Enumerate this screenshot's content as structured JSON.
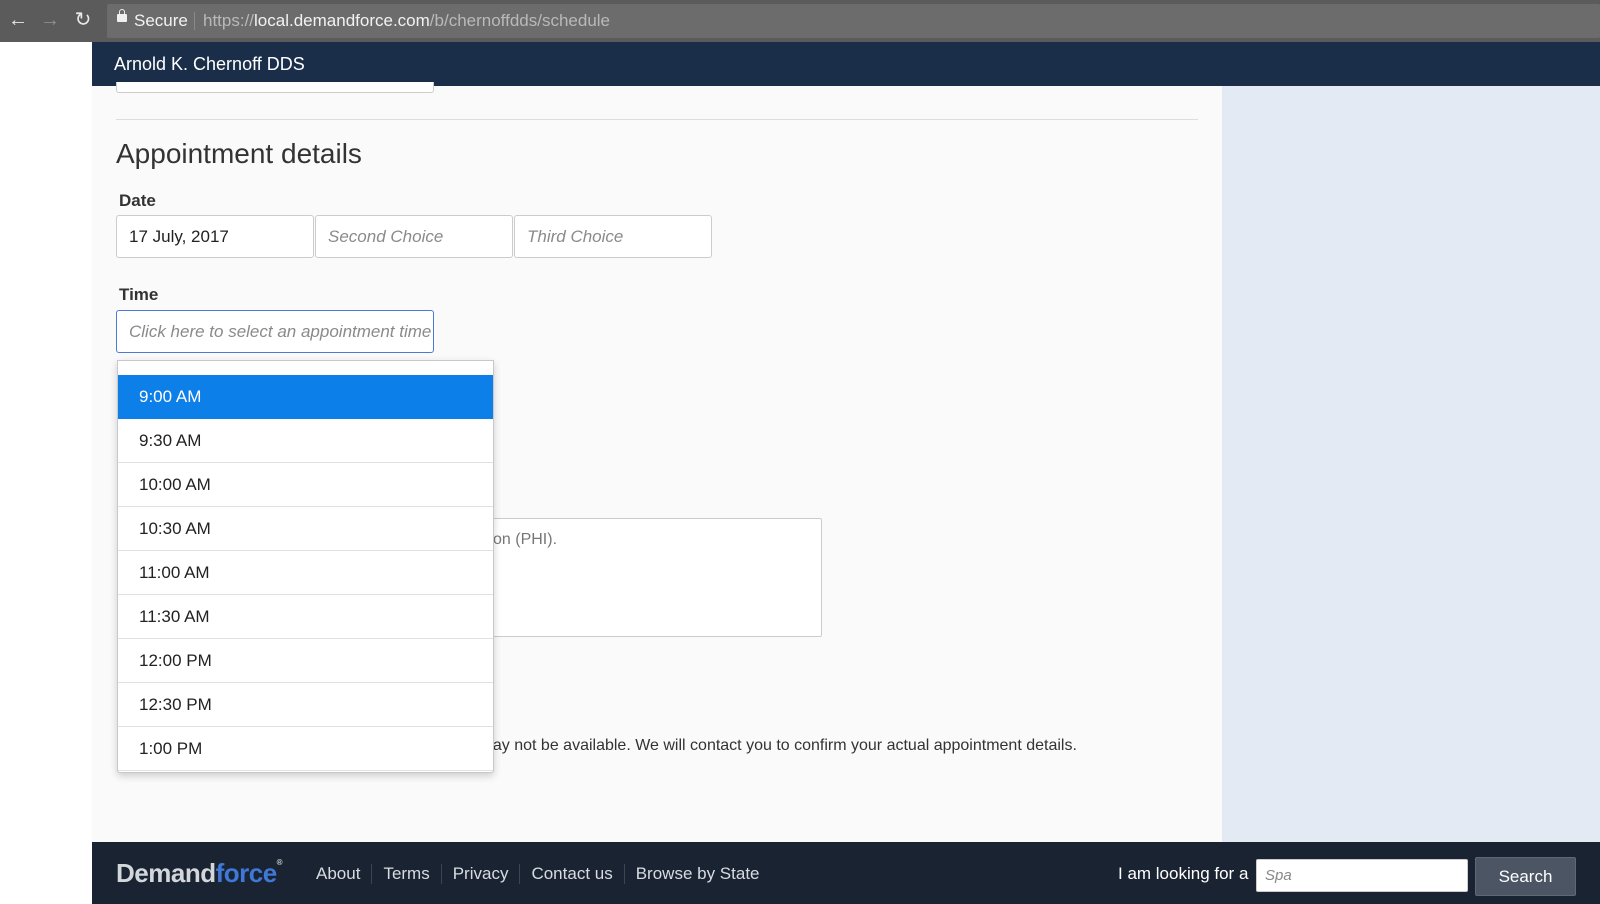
{
  "browser": {
    "secure_label": "Secure",
    "url_protocol": "https://",
    "url_host": "local.demandforce.com",
    "url_path": "/b/chernoffdds/schedule"
  },
  "header": {
    "practice_name": "Arnold K. Chernoff DDS"
  },
  "appointment": {
    "section_title": "Appointment details",
    "date_label": "Date",
    "date_value": "17 July, 2017",
    "second_choice_placeholder": "Second Choice",
    "third_choice_placeholder": "Third Choice",
    "time_label": "Time",
    "time_placeholder": "Click here to select an appointment time",
    "time_options": [
      "9:00 AM",
      "9:30 AM",
      "10:00 AM",
      "10:30 AM",
      "11:00 AM",
      "11:30 AM",
      "12:00 PM",
      "12:30 PM",
      "1:00 PM"
    ],
    "selected_time_index": 0,
    "phi_fragment": "tion (PHI).",
    "notice_fragment": "nay not be available. We will contact you to confirm your actual appointment details."
  },
  "footer": {
    "logo_part1": "Demand",
    "logo_part2": "force",
    "links": [
      "About",
      "Terms",
      "Privacy",
      "Contact us",
      "Browse by State"
    ],
    "looking_for_label": "I am looking for a",
    "search_placeholder": "Spa",
    "search_button": "Search"
  },
  "colors": {
    "header_navy": "#1a2e4a",
    "selected_blue": "#0d7fe8",
    "side_panel": "#e3eaf4",
    "footer_bg": "#1a2332"
  }
}
